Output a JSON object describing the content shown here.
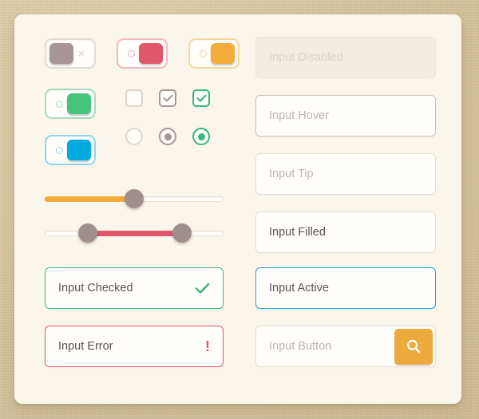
{
  "theme": {
    "page_background": "#d9c8a4",
    "card_background": "#faf6ec",
    "gray": "#a89697",
    "red": "#e0566b",
    "orange": "#eda93c",
    "green": "#3cb878",
    "blue": "#00a9e0",
    "text": "#5d5153",
    "placeholder": "#bdb4b2"
  },
  "toggles": [
    {
      "name": "toggle-gray-off",
      "state": "off",
      "knob_color": "#a89697",
      "border_color": "#e3dcd6",
      "accent": "#e3dcd6",
      "mark": "×"
    },
    {
      "name": "toggle-red-on",
      "state": "on",
      "knob_color": "#e0566b",
      "border_color": "#f0b9c1",
      "accent": "#efb0b9",
      "mark": "circle"
    },
    {
      "name": "toggle-orange-on",
      "state": "on",
      "knob_color": "#f3ac3c",
      "border_color": "#f6d79b",
      "accent": "#f3cf93",
      "mark": "circle"
    },
    {
      "name": "toggle-green-on",
      "state": "on",
      "knob_color": "#45c47e",
      "border_color": "#a6ddbd",
      "accent": "#a3dbbb",
      "mark": "circle"
    },
    {
      "name": "toggle-blue-on",
      "state": "on",
      "knob_color": "#00aadf",
      "border_color": "#8ed4ee",
      "accent": "#92d6ef",
      "mark": "circle"
    }
  ],
  "checkboxes": [
    {
      "name": "checkbox-empty",
      "checked": false,
      "border_color": "#ded4ce",
      "check_color": ""
    },
    {
      "name": "checkbox-checked-gray",
      "checked": true,
      "border_color": "#a89697",
      "check_color": "#a89697"
    },
    {
      "name": "checkbox-checked-green",
      "checked": true,
      "border_color": "#3cb878",
      "check_color": "#3cb878"
    }
  ],
  "radios": [
    {
      "name": "radio-empty",
      "selected": false,
      "border_color": "#ded4ce",
      "dot_color": ""
    },
    {
      "name": "radio-selected-gray",
      "selected": true,
      "border_color": "#a89697",
      "dot_color": "#a89697"
    },
    {
      "name": "radio-selected-green",
      "selected": true,
      "border_color": "#3cb878",
      "dot_color": "#3cb878"
    }
  ],
  "sliders": [
    {
      "name": "slider-single",
      "type": "single",
      "fill_color": "#f3ac3c",
      "value_percent": 50,
      "handle_color": "#a08e8f"
    },
    {
      "name": "slider-range",
      "type": "range",
      "fill_color": "#e0566b",
      "start_percent": 24,
      "end_percent": 77,
      "handle_color": "#a08e8f"
    }
  ],
  "fields": {
    "input_checked": {
      "label": "Input Checked",
      "state": "checked",
      "icon": "check-icon",
      "icon_glyph": "✓",
      "icon_color": "#3cb878",
      "border_color": "#3cb878"
    },
    "input_error": {
      "label": "Input Error",
      "state": "error",
      "icon": "exclamation-icon",
      "icon_glyph": "!",
      "icon_color": "#e0566b",
      "border_color": "#e0566b"
    },
    "input_disabled": {
      "label": "Input Disabled",
      "state": "disabled",
      "is_placeholder": true,
      "border_color": "#ece4d9"
    },
    "input_hover": {
      "label": "Input Hover",
      "state": "hover",
      "is_placeholder": true,
      "border_color": "#cdc2bb"
    },
    "input_tip": {
      "label": "Input Tip",
      "state": "default",
      "is_placeholder": true,
      "border_color": "#e6ded6"
    },
    "input_filled": {
      "label": "Input Filled",
      "state": "filled",
      "is_placeholder": false,
      "border_color": "#e6ded6"
    },
    "input_active": {
      "label": "Input Active",
      "state": "active",
      "is_placeholder": false,
      "border_color": "#1fa5d6"
    },
    "input_button": {
      "label": "Input Button",
      "state": "default",
      "is_placeholder": true,
      "border_color": "#e6ded6",
      "button": {
        "name": "search-button",
        "icon": "search-icon",
        "color": "#eda93c"
      }
    }
  }
}
